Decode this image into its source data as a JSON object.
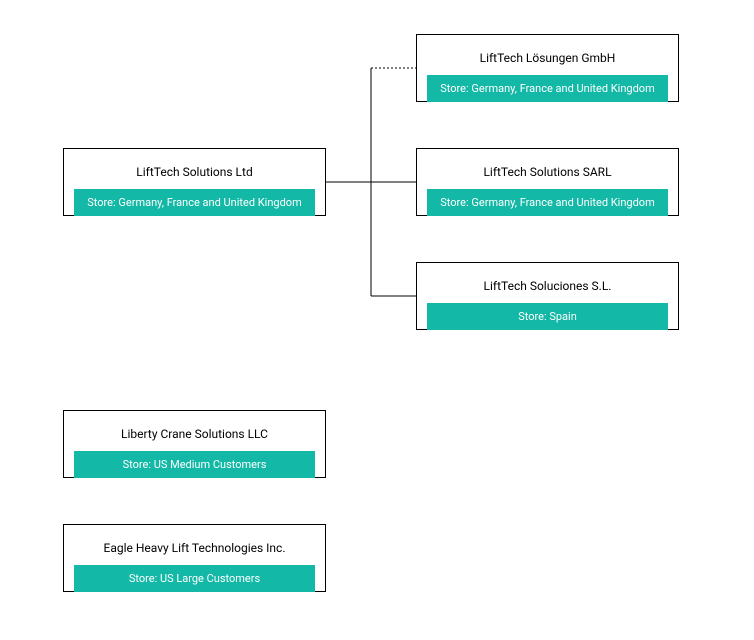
{
  "parent": {
    "title": "LiftTech Solutions Ltd",
    "store": "Store: Germany, France and United Kingdom"
  },
  "children": [
    {
      "title": "LiftTech Lösungen GmbH",
      "store": "Store: Germany, France and United Kingdom"
    },
    {
      "title": "LiftTech Solutions SARL",
      "store": "Store: Germany, France and United Kingdom"
    },
    {
      "title": "LiftTech Soluciones S.L.",
      "store": "Store: Spain"
    }
  ],
  "standalone": [
    {
      "title": "Liberty Crane Solutions LLC",
      "store": "Store: US Medium Customers"
    },
    {
      "title": "Eagle Heavy Lift Technologies Inc.",
      "store": "Store: US Large Customers"
    }
  ],
  "colors": {
    "accent": "#14b8a6"
  }
}
